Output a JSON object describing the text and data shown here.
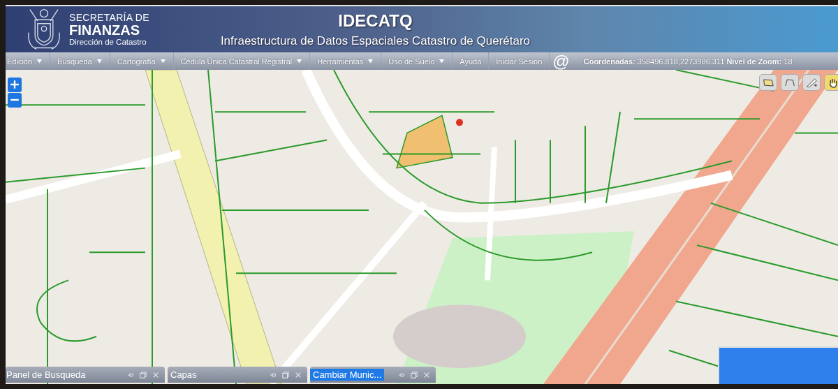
{
  "header": {
    "agency_line1": "SECRETARÍA DE",
    "agency_line2": "FINANZAS",
    "agency_line3": "Dirección de Catastro",
    "title": "IDECATQ",
    "subtitle": "Infraestructura de Datos Espaciales Catastro de Querétaro"
  },
  "menu": {
    "items": [
      {
        "label": "Edición",
        "dropdown": true
      },
      {
        "label": "Busqueda",
        "dropdown": true
      },
      {
        "label": "Cartografía",
        "dropdown": true
      },
      {
        "label": "Cédula Única Catastral Registral",
        "dropdown": true
      },
      {
        "label": "Herramientas",
        "dropdown": true
      },
      {
        "label": "Uso de Suelo",
        "dropdown": true
      },
      {
        "label": "Ayuda",
        "dropdown": false
      },
      {
        "label": "Iniciar Sesión",
        "dropdown": false
      }
    ],
    "email_symbol": "@",
    "status": "**Coordenadas:** 358496.818,2273986.311 **Nivel de Zoom:** 18"
  },
  "map": {
    "tools": [
      {
        "kind": "polygon",
        "selected": false
      },
      {
        "kind": "polyline",
        "selected": false
      },
      {
        "kind": "edit",
        "selected": false
      },
      {
        "kind": "pan",
        "selected": true
      }
    ],
    "panels": [
      {
        "title": "Panel de Busqueda",
        "selected": false
      },
      {
        "title": "Capas",
        "selected": false
      },
      {
        "title": "Cambiar Munic...",
        "selected": true
      }
    ]
  }
}
